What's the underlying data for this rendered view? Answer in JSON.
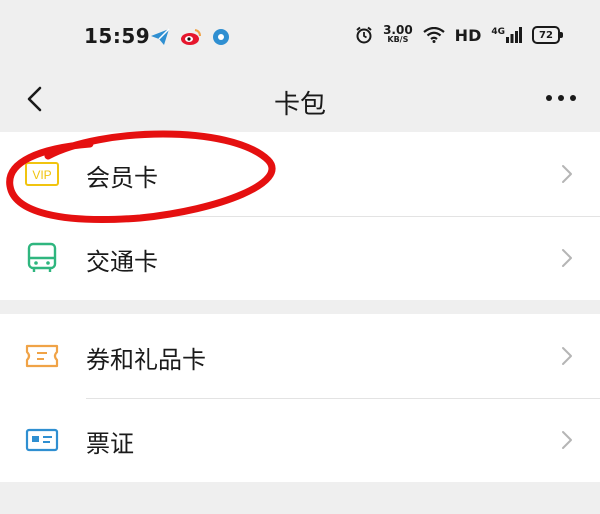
{
  "status": {
    "time": "15:59",
    "speed_value": "3.00",
    "speed_unit": "KB/S",
    "hd": "HD",
    "network": "4G",
    "battery": "72"
  },
  "nav": {
    "title": "卡包"
  },
  "cards": [
    {
      "label": "会员卡",
      "icon": "vip-icon",
      "icon_text": "VIP",
      "color": "#f1c40f"
    },
    {
      "label": "交通卡",
      "icon": "bus-icon",
      "color": "#2fb67f"
    },
    {
      "label": "券和礼品卡",
      "icon": "ticket-icon",
      "color": "#f0a347"
    },
    {
      "label": "票证",
      "icon": "id-card-icon",
      "color": "#2f8fd1"
    }
  ],
  "annotation_color": "#e51010"
}
